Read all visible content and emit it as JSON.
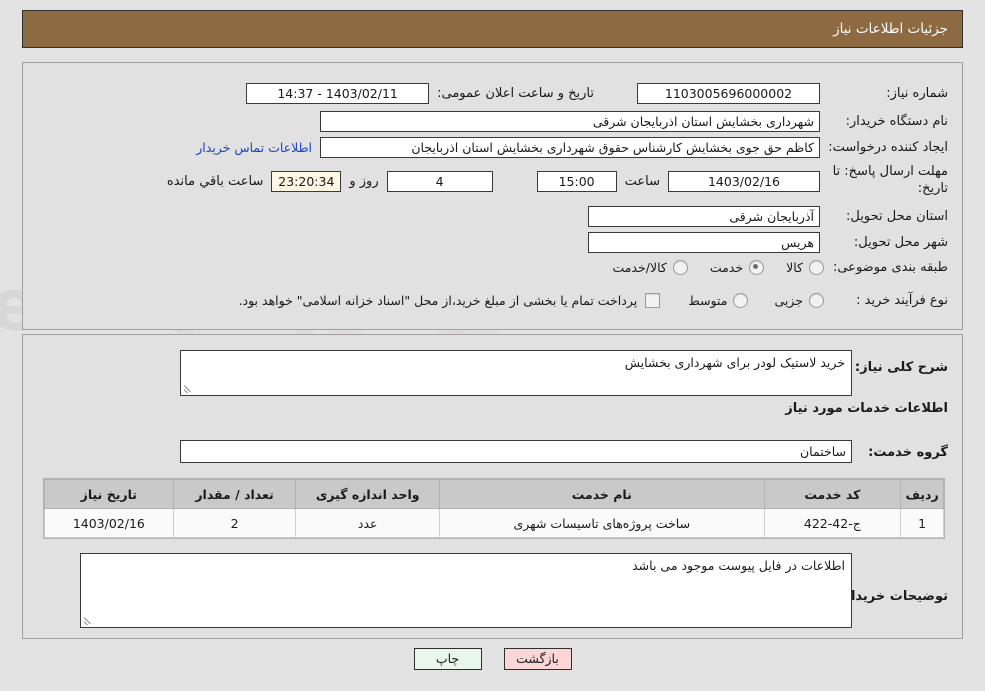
{
  "header": {
    "title": "جزئیات اطلاعات نیاز"
  },
  "watermark": {
    "text": "AnaTender.net"
  },
  "main": {
    "need_number": {
      "label": "شماره نیاز:",
      "value": "1103005696000002"
    },
    "public_announce": {
      "label": "تاریخ و ساعت اعلان عمومی:",
      "value": "1403/02/11 - 14:37"
    },
    "buyer_org": {
      "label": "نام دستگاه خریدار:",
      "value": "شهرداری بخشایش استان اذربایجان شرقی"
    },
    "request_creator": {
      "label": "ایجاد کننده درخواست:",
      "value": "کاظم حق جوی بخشایش کارشناس حقوق شهرداری بخشایش استان اذربایجان"
    },
    "buyer_contact_link": "اطلاعات تماس خریدار",
    "deadline": {
      "label": "مهلت ارسال پاسخ: تا تاریخ:",
      "label_line1": "مهلت ارسال پاسخ: تا",
      "label_line2": "تاریخ:",
      "date": "1403/02/16",
      "time_label": "ساعت",
      "time": "15:00",
      "days_value": "4",
      "days_label": "روز و",
      "countdown": "23:20:34",
      "countdown_label": "ساعت باقي مانده"
    },
    "province": {
      "label": "استان محل تحویل:",
      "value": "آذربایجان شرقی"
    },
    "city": {
      "label": "شهر محل تحویل:",
      "value": "هریس"
    },
    "classification": {
      "label": "طبقه بندی موضوعی:",
      "options": [
        {
          "label": "کالا",
          "selected": false
        },
        {
          "label": "خدمت",
          "selected": true
        },
        {
          "label": "کالا/خدمت",
          "selected": false
        }
      ]
    },
    "purchase_process": {
      "label": "نوع فرآیند خرید :",
      "options": [
        {
          "label": "جزیی",
          "selected": false
        },
        {
          "label": "متوسط",
          "selected": false
        }
      ],
      "treasury_note": "پرداخت تمام یا بخشی از مبلغ خرید،از محل \"اسناد خزانه اسلامی\" خواهد بود."
    }
  },
  "detail": {
    "general_desc": {
      "label": "شرح کلی نیاز:",
      "value": "خرید لاستیک لودر برای شهرداری بخشایش"
    },
    "services_section_title": "اطلاعات خدمات مورد نیاز",
    "service_group": {
      "label": "گروه خدمت:",
      "value": "ساختمان"
    },
    "table": {
      "columns": [
        "ردیف",
        "کد خدمت",
        "نام خدمت",
        "واحد اندازه گیری",
        "تعداد / مقدار",
        "تاریخ نیاز"
      ],
      "rows": [
        {
          "row_no": "1",
          "service_code": "ج-42-422",
          "service_name": "ساخت پروژه‌های تاسیسات شهری",
          "unit": "عدد",
          "quantity": "2",
          "need_date": "1403/02/16"
        }
      ]
    },
    "buyer_comments": {
      "label": "توضیحات خریدار:",
      "value": "اطلاعات در فایل پیوست موجود می باشد"
    }
  },
  "footer": {
    "print_label": "چاپ",
    "return_label": "بازگشت"
  },
  "colors": {
    "header_brown": "#8d6a41",
    "page_bg": "#e3e3e3",
    "panel_bg": "#e1e1e1",
    "link_blue": "#1b43c8",
    "table_header_gray": "#c9c9c9",
    "btn_print_green": "#e9f7ea",
    "btn_return_pink": "#fbd6d6"
  }
}
